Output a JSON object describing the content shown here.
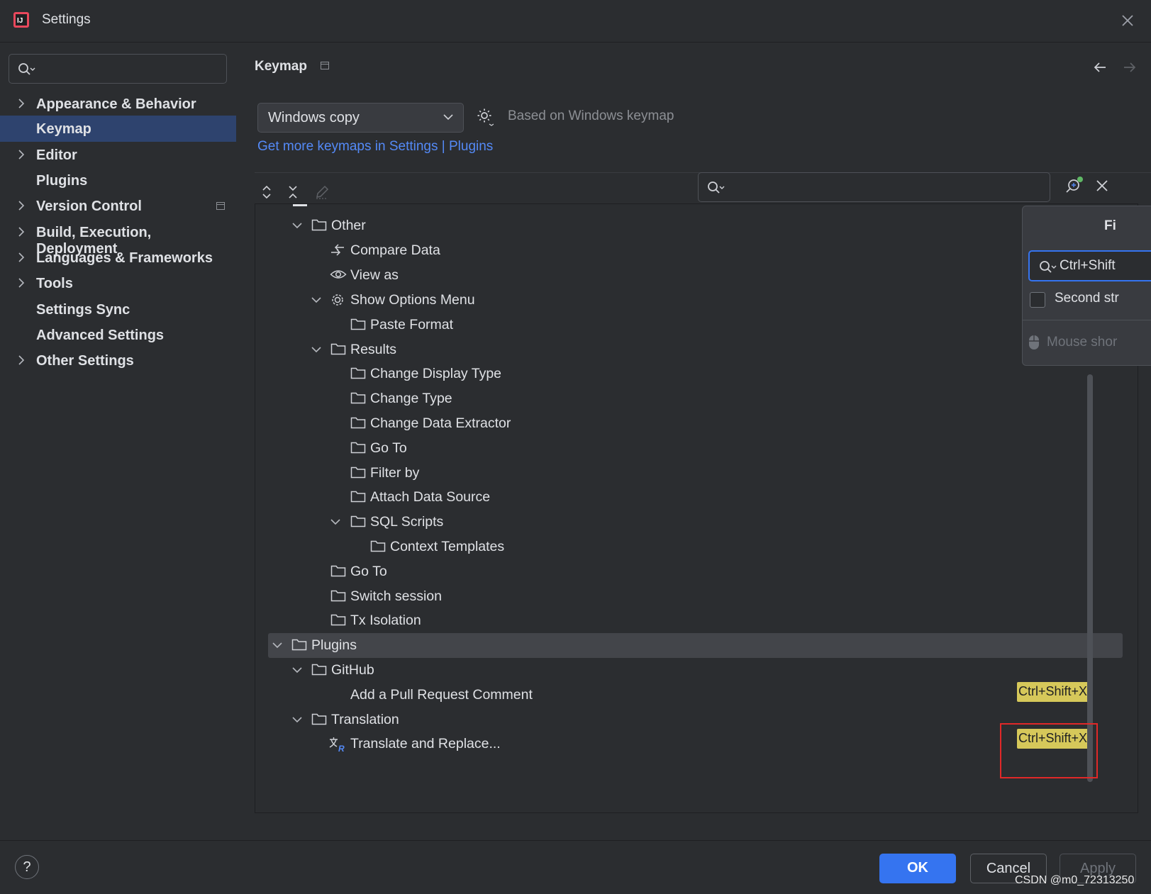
{
  "window": {
    "title": "Settings"
  },
  "sidebar": {
    "search_placeholder": "",
    "items": [
      {
        "label": "Appearance & Behavior",
        "expandable": true
      },
      {
        "label": "Keymap",
        "expandable": false,
        "selected": true
      },
      {
        "label": "Editor",
        "expandable": true
      },
      {
        "label": "Plugins",
        "expandable": false
      },
      {
        "label": "Version Control",
        "expandable": true
      },
      {
        "label": "Build, Execution, Deployment",
        "expandable": true
      },
      {
        "label": "Languages & Frameworks",
        "expandable": true
      },
      {
        "label": "Tools",
        "expandable": true
      },
      {
        "label": "Settings Sync",
        "expandable": false
      },
      {
        "label": "Advanced Settings",
        "expandable": false
      },
      {
        "label": "Other Settings",
        "expandable": true
      }
    ]
  },
  "keymap": {
    "title": "Keymap",
    "selected_keymap": "Windows copy",
    "based_on": "Based on Windows keymap",
    "more_link": "Get more keymaps in Settings | Plugins",
    "tree_search_value": ""
  },
  "tree": {
    "rows": [
      {
        "label": "Other",
        "icon": "folder-icon",
        "expanded": true
      },
      {
        "label": "Compare Data",
        "icon": "compare-icon"
      },
      {
        "label": "View as",
        "icon": "eye-icon"
      },
      {
        "label": "Show Options Menu",
        "icon": "gear-icon",
        "expanded": true
      },
      {
        "label": "Paste Format",
        "icon": "folder-icon"
      },
      {
        "label": "Results",
        "icon": "folder-icon",
        "expanded": true
      },
      {
        "label": "Change Display Type",
        "icon": "folder-icon"
      },
      {
        "label": "Change Type",
        "icon": "folder-icon"
      },
      {
        "label": "Change Data Extractor",
        "icon": "folder-icon"
      },
      {
        "label": "Go To",
        "icon": "folder-icon"
      },
      {
        "label": "Filter by",
        "icon": "folder-icon"
      },
      {
        "label": "Attach Data Source",
        "icon": "folder-icon"
      },
      {
        "label": "SQL Scripts",
        "icon": "folder-icon",
        "expanded": true
      },
      {
        "label": "Context Templates",
        "icon": "folder-icon"
      },
      {
        "label": "Go To",
        "icon": "folder-icon"
      },
      {
        "label": "Switch session",
        "icon": "folder-icon"
      },
      {
        "label": "Tx Isolation",
        "icon": "folder-icon"
      },
      {
        "label": "Plugins",
        "icon": "folder-icon",
        "expanded": true,
        "selected": true
      },
      {
        "label": "GitHub",
        "icon": "folder-icon",
        "expanded": true
      },
      {
        "label": "Add a Pull Request Comment",
        "icon": "none",
        "shortcut": "Ctrl+Shift+X"
      },
      {
        "label": "Translation",
        "icon": "folder-icon",
        "expanded": true
      },
      {
        "label": "Translate and Replace...",
        "icon": "translate-icon",
        "shortcut": "Ctrl+Shift+X"
      }
    ]
  },
  "popup": {
    "title": "Fi",
    "input_value": "Ctrl+Shift",
    "second_stroke_label": "Second str",
    "mouse_label": "Mouse shor"
  },
  "footer": {
    "help_label": "?",
    "ok_label": "OK",
    "cancel_label": "Cancel",
    "apply_label": "Apply",
    "watermark": "CSDN @m0_72313250"
  },
  "colors": {
    "background": "#2b2d30",
    "selection": "#2e436e",
    "accent": "#3574f0",
    "link": "#548af7",
    "shortcut_badge": "#d6c85a",
    "highlight_box": "#e02828"
  }
}
